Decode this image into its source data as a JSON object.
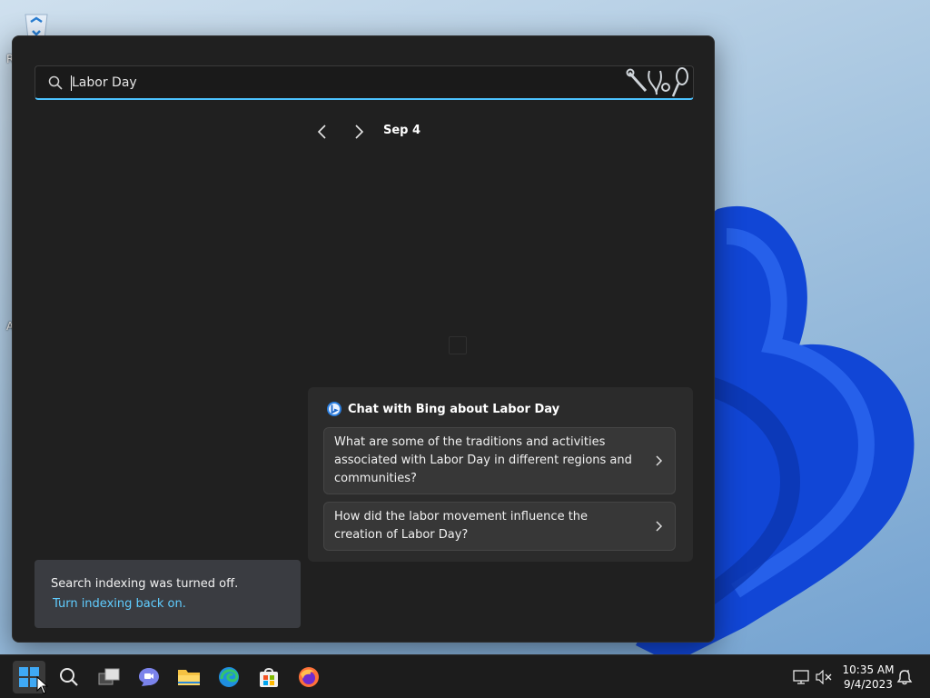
{
  "desktop": {
    "recycle_bin_icon": "recycle-bin",
    "edge_labels": [
      "R",
      "A"
    ]
  },
  "search": {
    "value": "Labor Day",
    "search_icon": "magnifier",
    "highlight_art": "tools-stethoscope-whisk"
  },
  "date_nav": {
    "prev_icon": "chevron-left",
    "next_icon": "chevron-right",
    "date": "Sep 4"
  },
  "bing": {
    "title": "Chat with Bing about Labor Day",
    "icon": "bing-chat",
    "suggestions": [
      "What are some of the traditions and activities associated with Labor Day in different regions and communities?",
      "How did the labor movement influence the creation of Labor Day?"
    ]
  },
  "indexing": {
    "message": "Search indexing was turned off.",
    "link": "Turn indexing back on."
  },
  "taskbar": {
    "apps": [
      "start",
      "search",
      "task-view",
      "teams-chat",
      "file-explorer",
      "edge",
      "microsoft-store",
      "firefox"
    ],
    "tray": [
      "network",
      "volume-muted"
    ],
    "time": "10:35 AM",
    "date": "9/4/2023",
    "notification_icon": "notification-bell"
  },
  "colors": {
    "accent": "#4cc2ff",
    "link": "#60cdff",
    "panel": "#202020",
    "card": "#2b2b2b",
    "taskbar": "#1c1c1c"
  }
}
